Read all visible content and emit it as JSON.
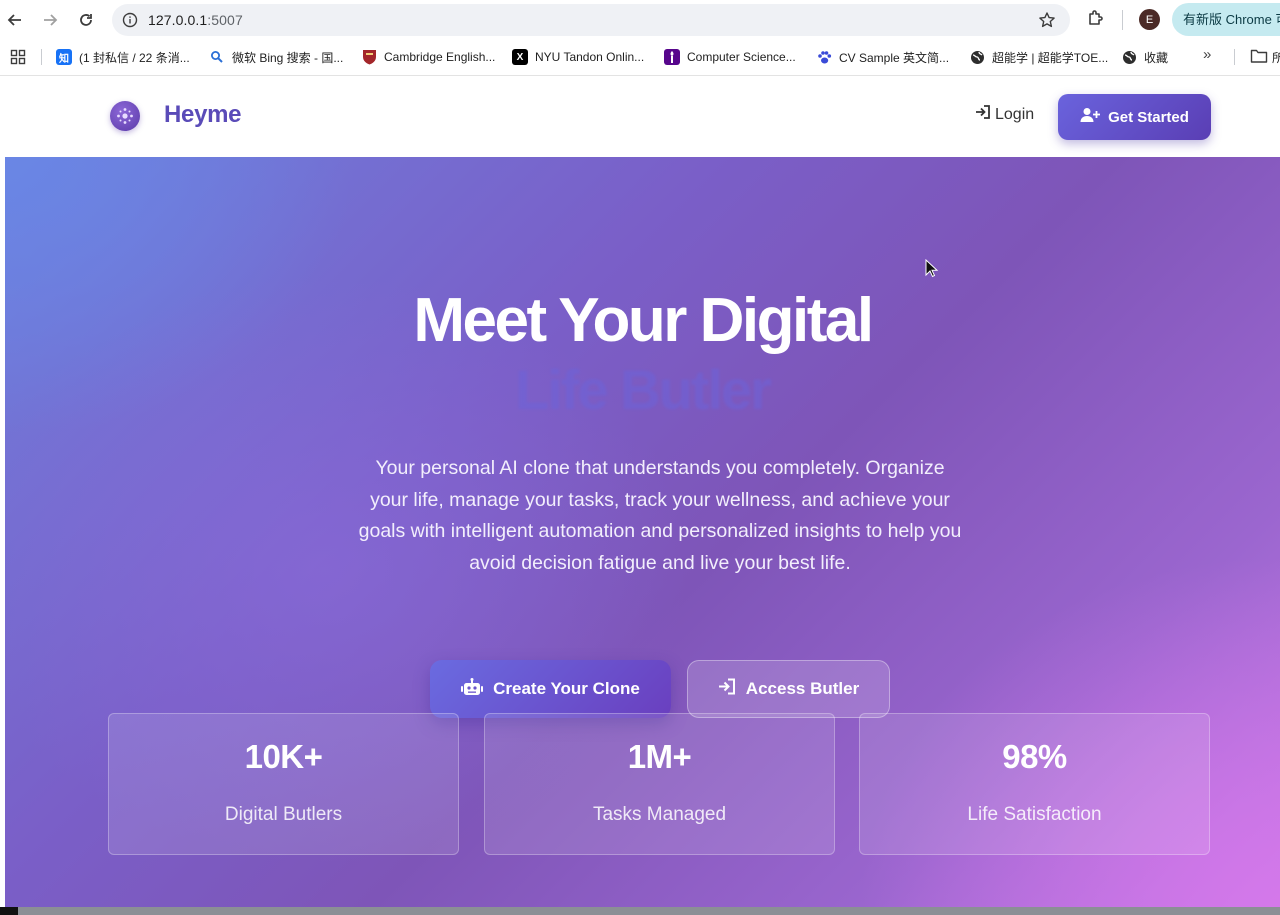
{
  "browser": {
    "url_host": "127.0.0.1",
    "url_port": ":5007",
    "profile_initial": "E",
    "update_label": "有新版 Chrome 可",
    "bookmarks": [
      {
        "label": "(1 封私信 / 22 条消...",
        "icon": "zhihu-icon",
        "color": "#1772f6",
        "glyph": "知"
      },
      {
        "label": "微软 Bing 搜索 - 国...",
        "icon": "bing-search-icon",
        "color": "#ffffff",
        "glyph": ""
      },
      {
        "label": "Cambridge English...",
        "icon": "cambridge-shield-icon",
        "color": "#a3262a",
        "glyph": ""
      },
      {
        "label": "NYU Tandon Onlin...",
        "icon": "x-logo-icon",
        "color": "#000000",
        "glyph": "X"
      },
      {
        "label": "Computer Science...",
        "icon": "purple-torch-icon",
        "color": "#57068c",
        "glyph": ""
      },
      {
        "label": "CV Sample 英文简...",
        "icon": "paw-icon",
        "color": "#ffffff",
        "glyph": ""
      },
      {
        "label": "超能学 | 超能学TOE...",
        "icon": "globe-icon",
        "color": "#ffffff",
        "glyph": ""
      },
      {
        "label": "收藏",
        "icon": "globe-icon",
        "color": "#ffffff",
        "glyph": ""
      }
    ],
    "folder_label": "所"
  },
  "header": {
    "brand": "Heyme",
    "login_label": "Login",
    "get_started_label": "Get Started"
  },
  "hero": {
    "title": "Meet Your Digital",
    "subtitle": "Life Butler",
    "description": "Your personal AI clone that understands you completely. Organize your life, manage your tasks, track your wellness, and achieve your goals with intelligent automation and personalized insights to help you avoid decision fatigue and live your best life.",
    "primary_cta": "Create Your Clone",
    "secondary_cta": "Access Butler"
  },
  "stats": [
    {
      "value": "10K+",
      "label": "Digital Butlers"
    },
    {
      "value": "1M+",
      "label": "Tasks Managed"
    },
    {
      "value": "98%",
      "label": "Life Satisfaction"
    }
  ],
  "colors": {
    "brand": "#5a4bb8",
    "accent_start": "#6a63dd",
    "accent_end": "#5a3eb4",
    "hero_gradient_start": "#6e7fdc",
    "hero_gradient_end": "#c478e6"
  }
}
